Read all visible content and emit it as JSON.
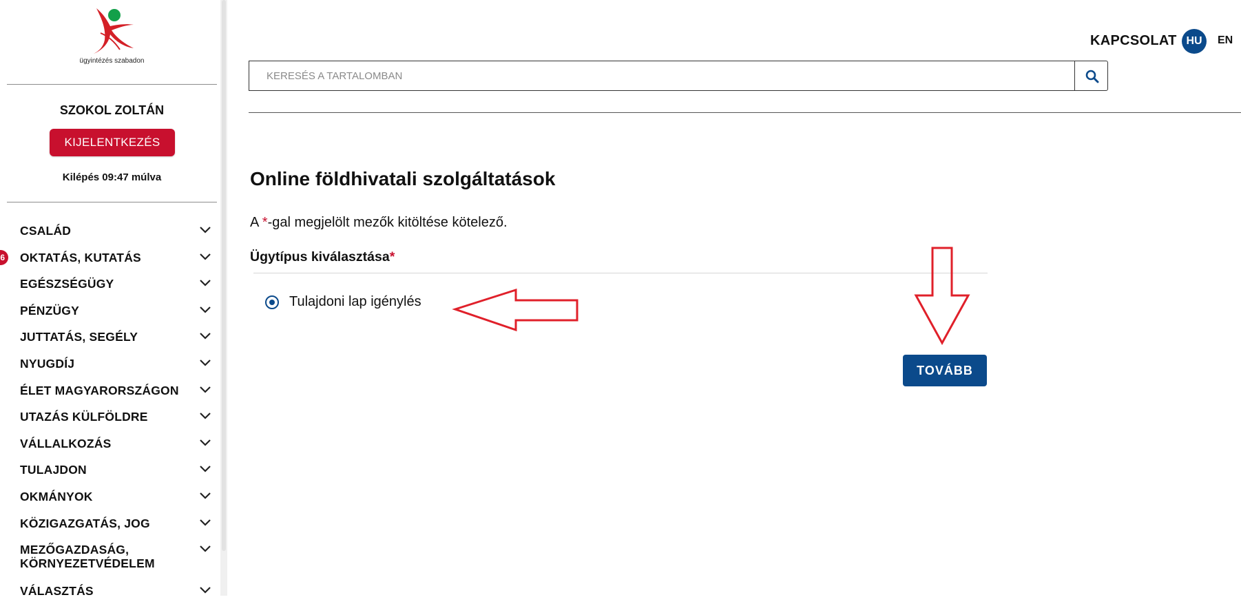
{
  "sidebar": {
    "logo_text": "ügyintézés szabadon",
    "user_name": "SZOKOL ZOLTÁN",
    "logout_label": "KIJELENTKEZÉS",
    "session_timer": "Kilépés 09:47 múlva",
    "items": [
      {
        "label": "CSALÁD"
      },
      {
        "label": "OKTATÁS, KUTATÁS",
        "badge": "6"
      },
      {
        "label": "EGÉSZSÉGÜGY"
      },
      {
        "label": "PÉNZÜGY"
      },
      {
        "label": "JUTTATÁS, SEGÉLY"
      },
      {
        "label": "NYUGDÍJ"
      },
      {
        "label": "ÉLET MAGYARORSZÁGON"
      },
      {
        "label": "UTAZÁS KÜLFÖLDRE"
      },
      {
        "label": "VÁLLALKOZÁS"
      },
      {
        "label": "TULAJDON"
      },
      {
        "label": "OKMÁNYOK"
      },
      {
        "label": "KÖZIGAZGATÁS, JOG"
      },
      {
        "label_line1": "MEZŐGAZDASÁG,",
        "label_line2": "KÖRNYEZETVÉDELEM"
      },
      {
        "label": "VÁLASZTÁS"
      }
    ]
  },
  "header": {
    "contact_label": "KAPCSOLAT",
    "lang_hu": "HU",
    "lang_en": "EN",
    "search_placeholder": "KERESÉS A TARTALOMBAN"
  },
  "main": {
    "title": "Online földhivatali szolgáltatások",
    "required_note_prefix": "A ",
    "required_note_star": "*",
    "required_note_suffix": "-gal megjelölt mezők kitöltése kötelező.",
    "field_label": "Ügytípus kiválasztása",
    "field_required_star": "*",
    "radio_option_label": "Tulajdoni lap igénylés",
    "radio_selected": true,
    "next_label": "TOVÁBB"
  },
  "colors": {
    "brand_blue": "#0b4a8b",
    "brand_red": "#c8102e",
    "annotation_red": "#e0202a"
  },
  "icons": {
    "search": "search-icon",
    "chevron": "chevron-down-icon",
    "logo": "logo-icon"
  }
}
